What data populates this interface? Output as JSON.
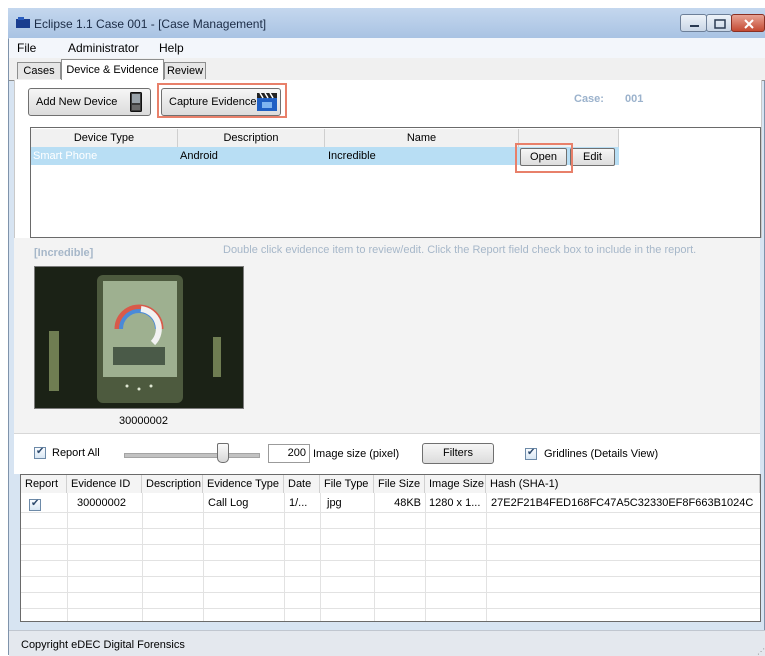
{
  "window": {
    "title": "Eclipse 1.1  Case 001 - [Case Management]"
  },
  "menu": {
    "items": [
      "File",
      "Administrator",
      "Help"
    ]
  },
  "tabs": [
    "Cases",
    "Device & Evidence",
    "Review"
  ],
  "toolbar": {
    "add_device": "Add New Device",
    "capture_evidence": "Capture Evidence"
  },
  "case": {
    "label": "Case:",
    "value": "001"
  },
  "device_grid": {
    "columns": [
      "Device Type",
      "Description",
      "Name"
    ],
    "rows": [
      {
        "device_type": "Smart Phone",
        "description": "Android",
        "name": "Incredible",
        "open": "Open",
        "edit": "Edit"
      }
    ]
  },
  "evidence": {
    "device_name": "[Incredible]",
    "hint": "Double click evidence item to review/edit. Click the Report field check box to include in the report.",
    "thumbnail_caption": "30000002"
  },
  "options": {
    "report_all": "Report All",
    "image_size_value": "200",
    "image_size_label": "Image size (pixel)",
    "filters": "Filters",
    "gridlines": "Gridlines (Details View)"
  },
  "evidence_table": {
    "columns": [
      "Report",
      "Evidence ID",
      "Description",
      "Evidence Type",
      "Date",
      "File Type",
      "File Size",
      "Image Size",
      "Hash (SHA-1)"
    ],
    "rows": [
      {
        "report": true,
        "evidence_id": "30000002",
        "description": "",
        "evidence_type": "Call Log",
        "date": "1/...",
        "file_type": "jpg",
        "file_size": "48KB",
        "image_size": "1280 x 1...",
        "hash": "27E2F21B4FED168FC47A5C32330EF8F663B1024C"
      }
    ]
  },
  "status": {
    "text": "Copyright eDEC Digital Forensics"
  },
  "colors": {
    "selection": "#b8def4",
    "highlight": "#e8806a",
    "muted_text": "#a6b7c9"
  }
}
